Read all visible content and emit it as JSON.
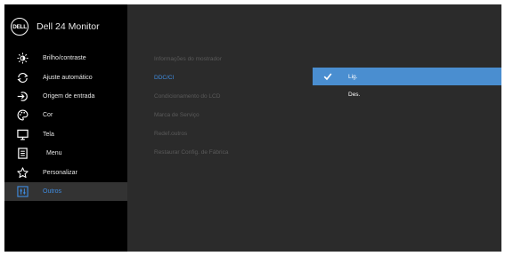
{
  "header": {
    "logo_text": "DELL",
    "title": "Dell 24 Monitor"
  },
  "sidebar": {
    "items": [
      {
        "label": "Brilho/contraste",
        "icon": "brightness-icon"
      },
      {
        "label": "Ajuste automático",
        "icon": "auto-adjust-icon"
      },
      {
        "label": "Origem de entrada",
        "icon": "input-source-icon"
      },
      {
        "label": "Cor",
        "icon": "color-icon"
      },
      {
        "label": "Tela",
        "icon": "display-icon"
      },
      {
        "label": "Menu",
        "icon": "menu-icon"
      },
      {
        "label": "Personalizar",
        "icon": "star-icon"
      },
      {
        "label": "Outros",
        "icon": "others-icon",
        "active": true
      }
    ]
  },
  "submenu": {
    "items": [
      {
        "label": "Informações do mostrador"
      },
      {
        "label": "DDC/CI",
        "active": true
      },
      {
        "label": "Condicionamento do LCD"
      },
      {
        "label": "Marca de Serviço"
      },
      {
        "label": "Redef.outros"
      },
      {
        "label": "Restaurar Config. de Fábrica"
      }
    ]
  },
  "options": {
    "items": [
      {
        "label": "Lig.",
        "selected": true,
        "icon": "checkmark-icon"
      },
      {
        "label": "Des.",
        "selected": false
      }
    ]
  },
  "colors": {
    "accent": "#3f8ce0",
    "selected_bg": "#4a8ed0",
    "panel_bg": "#2b2b2b",
    "sidebar_bg": "#000000"
  }
}
